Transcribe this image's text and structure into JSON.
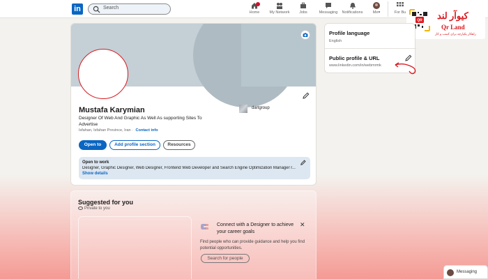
{
  "topbar": {
    "logo_text": "in",
    "search_placeholder": "Search",
    "nav": [
      {
        "label": "Home",
        "icon": "home-icon",
        "badge": true
      },
      {
        "label": "My Network",
        "icon": "network-icon"
      },
      {
        "label": "Jobs",
        "icon": "briefcase-icon"
      },
      {
        "label": "Messaging",
        "icon": "chat-icon"
      },
      {
        "label": "Notifications",
        "icon": "bell-icon"
      },
      {
        "label": "Me",
        "icon": "avatar-icon"
      },
      {
        "label": "For Bu",
        "icon": "grid-icon"
      }
    ]
  },
  "profile": {
    "name": "Mustafa Karymian",
    "headline": "Designer Of Web And Graphic As Well As supporting Sites To Advertise",
    "location": "Isfahan, Isfahan Province, Iran ·",
    "contact_link": "Contact info",
    "company": "dartgroup",
    "buttons": {
      "open_to": "Open to",
      "add_section": "Add profile section",
      "resources": "Resources"
    },
    "open_to_work": {
      "title": "Open to work",
      "roles": "Designer, Graphic Designer, Web Designer, Frontend Web Developer and Search Engine Optimization Manager r...",
      "show_details": "Show details"
    }
  },
  "suggested": {
    "title": "Suggested for you",
    "privacy": "Private to you",
    "card": {
      "heading": "Connect with a Designer to achieve your career goals",
      "close": "✕",
      "body": "Find people who can provide guidance and help you find potential opportunities.",
      "button": "Search for people"
    }
  },
  "sidebar": {
    "profile_language_label": "Profile language",
    "profile_language_value": "English",
    "public_profile_label": "Public profile & URL",
    "public_profile_url": "www.linkedin.com/in/webmrmk"
  },
  "brand": {
    "title": "کیوآر لند",
    "subtitle": "Qr Land",
    "tagline": "راهکار یکپارچه برای کسب و کار"
  },
  "messaging": {
    "label": "Messaging"
  },
  "colors": {
    "accent": "#0a66c2",
    "brand_red": "#d9191f",
    "banner": "#c4cfd6"
  }
}
